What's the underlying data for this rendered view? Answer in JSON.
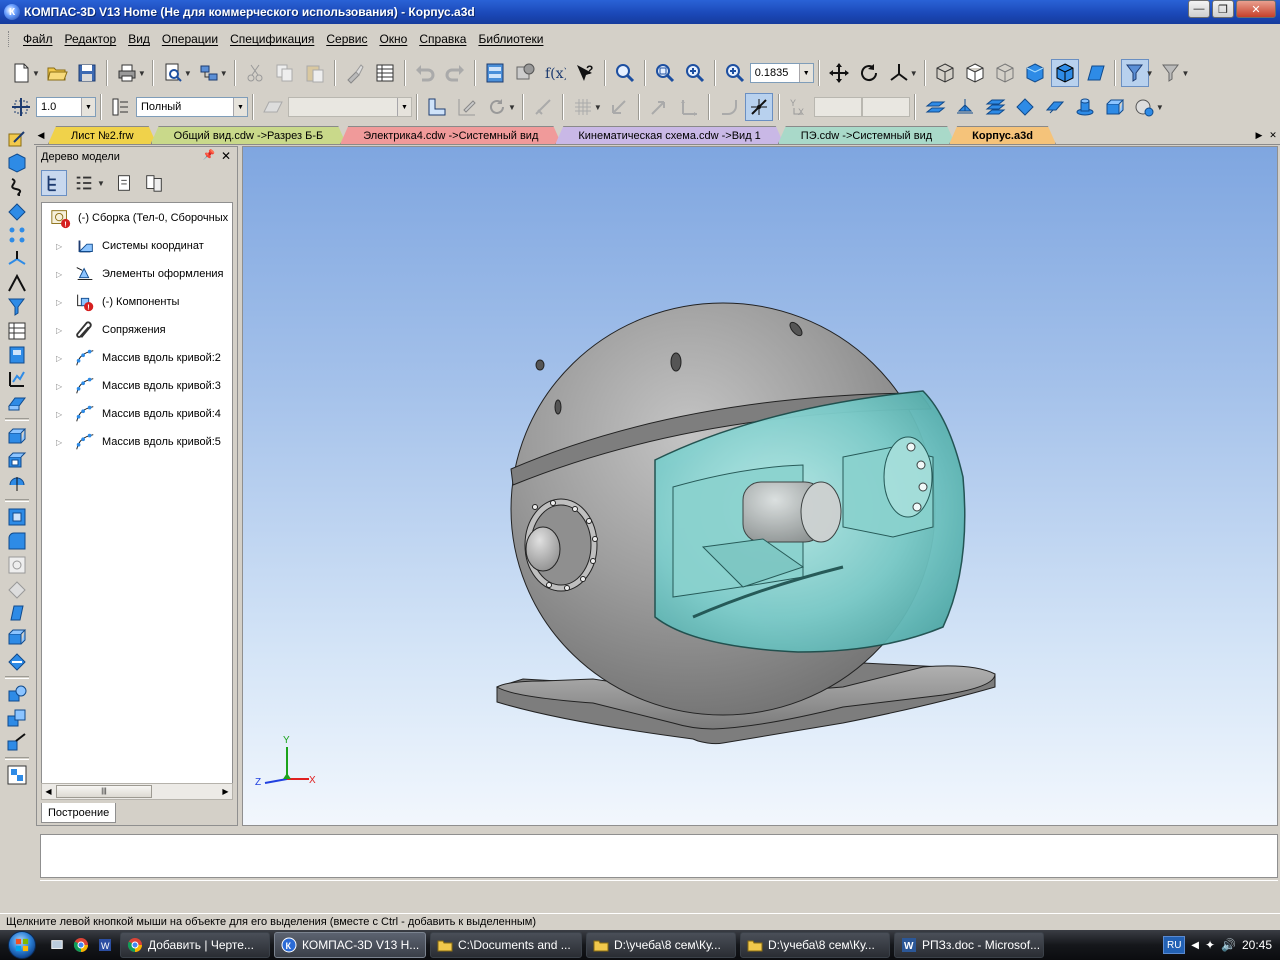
{
  "window": {
    "title": "КОМПАС-3D V13 Home (Не для коммерческого использования) - Корпус.a3d",
    "app_icon_letter": "К"
  },
  "menu": [
    "Файл",
    "Редактор",
    "Вид",
    "Операции",
    "Спецификация",
    "Сервис",
    "Окно",
    "Справка",
    "Библиотеки"
  ],
  "toolbar1": {
    "zoom_value": "0.1835"
  },
  "toolbar2": {
    "step_value": "1.0",
    "style_value": "Полный"
  },
  "doc_tabs": [
    {
      "label": "Лист №2.frw",
      "color": "#f0d24a",
      "active": false
    },
    {
      "label": "Общий вид.cdw ->Разрез Б-Б",
      "color": "#c9d98a",
      "active": false
    },
    {
      "label": "Электрика4.cdw ->Системный вид",
      "color": "#f09a9a",
      "active": false
    },
    {
      "label": "Кинематическая схема.cdw ->Вид 1",
      "color": "#c9b8e6",
      "active": false
    },
    {
      "label": "ПЭ.cdw ->Системный вид",
      "color": "#a9d9c9",
      "active": false
    },
    {
      "label": "Корпус.a3d",
      "color": "#f5c37a",
      "active": true
    }
  ],
  "tree": {
    "header": "Дерево модели",
    "root": "(-) Сборка (Тел-0, Сборочных",
    "items": [
      "Системы координат",
      "Элементы оформления",
      "(-) Компоненты",
      "Сопряжения",
      "Массив вдоль кривой:2",
      "Массив вдоль кривой:3",
      "Массив вдоль кривой:4",
      "Массив вдоль кривой:5"
    ],
    "tab_label": "Построение"
  },
  "axes": {
    "y": "Y",
    "z": "Z",
    "x": "X"
  },
  "status": "Щелкните левой кнопкой мыши на объекте для его выделения (вместе с Ctrl - добавить к выделенным)",
  "taskbar": {
    "items": [
      {
        "label": "Добавить | Черте...",
        "icon": "chrome-icon",
        "active": false
      },
      {
        "label": "КОМПАС-3D V13 H...",
        "icon": "kompas-icon",
        "active": true
      },
      {
        "label": "C:\\Documents and ...",
        "icon": "folder-icon",
        "active": false
      },
      {
        "label": "D:\\учеба\\8 сем\\Ку...",
        "icon": "folder-icon",
        "active": false
      },
      {
        "label": "D:\\учеба\\8 сем\\Ку...",
        "icon": "folder-icon",
        "active": false
      },
      {
        "label": "РПЗз.doc - Microsof...",
        "icon": "word-icon",
        "active": false
      }
    ],
    "lang": "RU",
    "time": "20:45"
  }
}
